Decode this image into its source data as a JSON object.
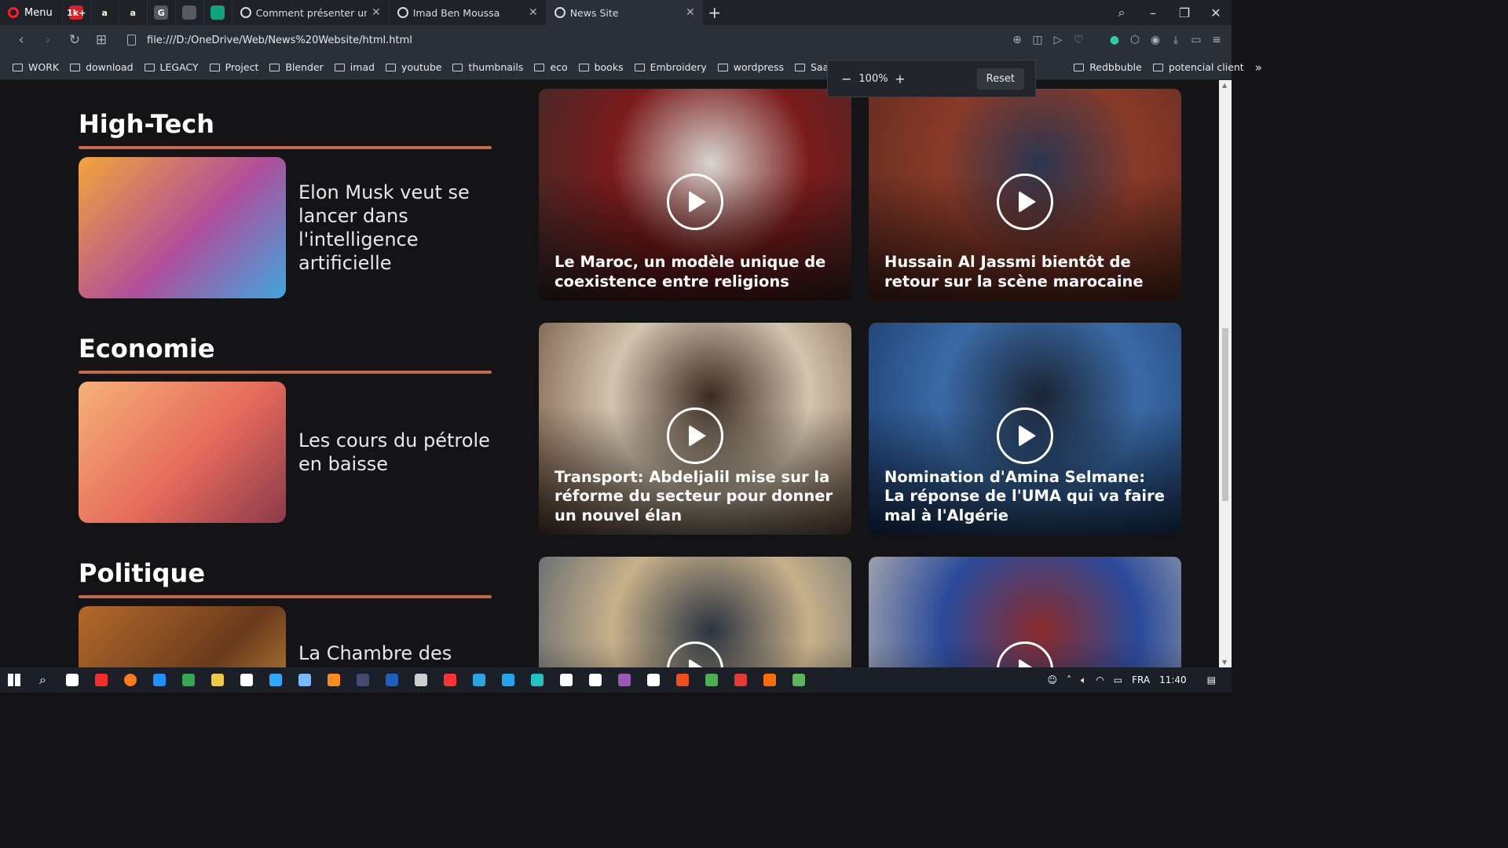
{
  "browser": {
    "menu_label": "Menu",
    "pinned": [
      {
        "name": "tab-pin-ytpro",
        "text": "1k+",
        "color": "#d6202a"
      },
      {
        "name": "tab-pin-amazon-a",
        "text": "a",
        "color": "#222222"
      },
      {
        "name": "tab-pin-amazon-b",
        "text": "a",
        "color": "#222222"
      },
      {
        "name": "tab-pin-chatgpt",
        "text": "G",
        "color": "#555b63"
      },
      {
        "name": "tab-pin-globe",
        "text": "",
        "color": "#555b63"
      },
      {
        "name": "tab-pin-openai",
        "text": "",
        "color": "#10a37f"
      }
    ],
    "tabs": [
      {
        "label": "Comment présenter un pro",
        "active": false
      },
      {
        "label": "Imad Ben Moussa",
        "active": false
      },
      {
        "label": "News Site",
        "active": true
      }
    ],
    "new_tab": "+",
    "url": "file:///D:/OneDrive/Web/News%20Website/html.html",
    "bookmarks": [
      "WORK",
      "download",
      "LEGACY",
      "Project",
      "Blender",
      "imad",
      "youtube",
      "thumbnails",
      "eco",
      "books",
      "Embroidery",
      "wordpress",
      "SaaS",
      "",
      "Redbbuble",
      "potencial client"
    ],
    "bookmarks_more": "»",
    "zoom": {
      "minus": "−",
      "value": "100%",
      "plus": "+",
      "reset": "Reset"
    }
  },
  "sections": [
    {
      "heading": "High-Tech",
      "story": "Elon Musk veut se lancer dans l'intelligence artificielle",
      "thumb_colors": [
        "#f3a53a",
        "#b04e9a",
        "#3fa6de"
      ]
    },
    {
      "heading": "Economie",
      "story": "Les cours du pétrole en baisse",
      "thumb_colors": [
        "#f6b27a",
        "#e56a5a",
        "#8a3b4b"
      ]
    },
    {
      "heading": "Politique",
      "story": "La Chambre des conseillers adopte le",
      "thumb_colors": [
        "#b46a2a",
        "#6a3a1c",
        "#d69a3a"
      ]
    }
  ],
  "videos": [
    {
      "title": "Le Maroc, un modèle unique de coexistence entre religions",
      "colors": [
        "#3b2c2c",
        "#7a1b1b",
        "#d8d4cf"
      ]
    },
    {
      "title": "Hussain Al Jassmi bientôt de retour sur la scène marocaine",
      "colors": [
        "#5a2a1e",
        "#8a3a28",
        "#2b3550"
      ]
    },
    {
      "title": "Transport: Abdeljalil mise sur la réforme du secteur pour donner un nouvel élan",
      "colors": [
        "#6a4a36",
        "#d2c4ae",
        "#3a2a22"
      ]
    },
    {
      "title": "Nomination d'Amina Selmane: La réponse de l'UMA qui va faire mal à l'Algérie",
      "colors": [
        "#1a3a6a",
        "#3a6aa6",
        "#1a2434"
      ]
    },
    {
      "title": "",
      "colors": [
        "#4a5a6a",
        "#c8b08a",
        "#2a3440"
      ]
    },
    {
      "title": "",
      "colors": [
        "#c8c2b4",
        "#2a4a9a",
        "#8a2a2a"
      ]
    }
  ],
  "taskbar": {
    "apps": [
      "#ffffff",
      "#ff2b2b",
      "#ff7a1a",
      "#1e90ff",
      "#34a853",
      "#f2c744",
      "#ffffff",
      "#31a8ff",
      "#7ab8ff",
      "#ff8c1a",
      "#444a73",
      "#1f5fbf",
      "#cfcfcf",
      "#ff3333",
      "#2aa3e0",
      "#23a6f0",
      "#22c1c3",
      "#ffffff",
      "#ffffff",
      "#9b59b6",
      "#ffffff",
      "#f24e1e",
      "#4caf50",
      "#e53935",
      "#ff6d00",
      "#5bb55b"
    ],
    "lang": "FRA",
    "time": "11:40"
  },
  "colors": {
    "accent_rule": "#c4694f",
    "page_bg": "#141416",
    "chrome_bg": "#2b3038"
  }
}
